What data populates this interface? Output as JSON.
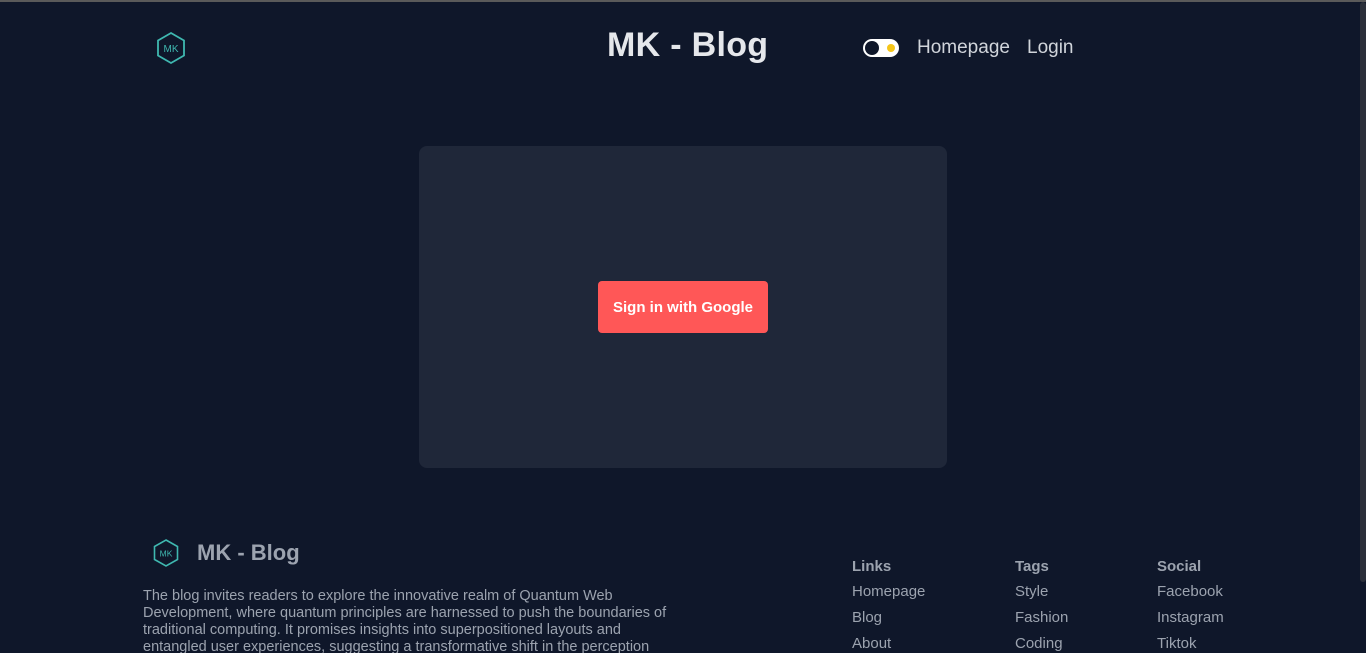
{
  "header": {
    "logo_text": "MK",
    "title": "MK - Blog",
    "nav": [
      {
        "label": "Homepage"
      },
      {
        "label": "Login"
      }
    ]
  },
  "login": {
    "google_button_label": "Sign in with Google"
  },
  "footer": {
    "logo_text": "MK",
    "title": "MK - Blog",
    "description": "The blog invites readers to explore the innovative realm of Quantum Web Development, where quantum principles are harnessed to push the boundaries of traditional computing. It promises insights into superpositioned layouts and entangled user experiences, suggesting a transformative shift in the perception",
    "columns": [
      {
        "heading": "Links",
        "items": [
          "Homepage",
          "Blog",
          "About"
        ]
      },
      {
        "heading": "Tags",
        "items": [
          "Style",
          "Fashion",
          "Coding"
        ]
      },
      {
        "heading": "Social",
        "items": [
          "Facebook",
          "Instagram",
          "Tiktok"
        ]
      }
    ]
  },
  "colors": {
    "background": "#0f172a",
    "card": "#1f2739",
    "accent_button": "#ff5757",
    "logo_teal": "#3fb8b0"
  },
  "icons": {
    "logo": "hexagon-logo-icon",
    "theme": "theme-toggle-icon"
  }
}
